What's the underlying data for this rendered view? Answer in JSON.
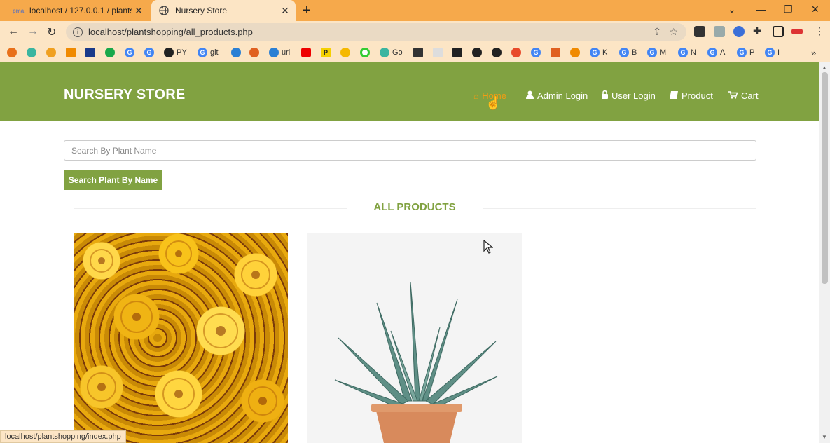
{
  "browser": {
    "tabs": [
      {
        "title": "localhost / 127.0.0.1 / plantshopp",
        "icon": "phpmyadmin-icon",
        "active": false
      },
      {
        "title": "Nursery Store",
        "icon": "globe-icon",
        "active": true
      }
    ],
    "address": "localhost/plantshopping/all_products.php",
    "bookmarks": [
      "PY",
      "git",
      "url",
      "Go",
      "K",
      "B",
      "M",
      "N",
      "A",
      "P",
      "I"
    ],
    "status_url": "localhost/plantshopping/index.php"
  },
  "site": {
    "brand": "NURSERY STORE",
    "nav": [
      {
        "label": "Home",
        "icon": "home-icon"
      },
      {
        "label": "Admin Login",
        "icon": "user-icon"
      },
      {
        "label": "User Login",
        "icon": "lock-icon"
      },
      {
        "label": "Product",
        "icon": "book-icon"
      },
      {
        "label": "Cart",
        "icon": "cart-icon"
      }
    ],
    "accent_color": "#81a241",
    "active_nav_color": "#f39c12"
  },
  "search": {
    "placeholder": "Search By Plant Name",
    "button_label": "Search Plant By Name"
  },
  "products": {
    "section_title": "ALL PRODUCTS",
    "items": [
      {
        "image": "marigold-flowers"
      },
      {
        "image": "agave-succulent-in-pot"
      }
    ]
  }
}
